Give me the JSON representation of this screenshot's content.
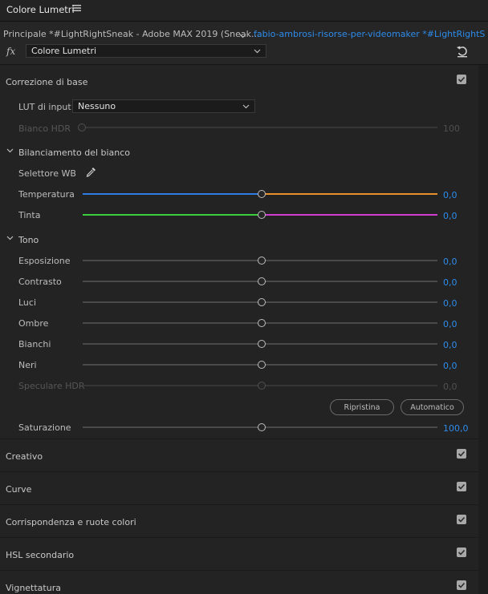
{
  "panel": {
    "title": "Colore Lumetri",
    "menu_icon": "hamburger-icon"
  },
  "sequence": {
    "left": "Principale *#LightRightSneak - Adobe MAX 2019 (Sneak...",
    "right": "fabio-ambrosi-risorse-per-videomaker *#LightRightS..."
  },
  "effect": {
    "fx_label": "fx",
    "selected": "Colore Lumetri",
    "reset_icon": "reset-icon"
  },
  "colors": {
    "accent": "#2d8ceb",
    "temp_cool": "#2f7de0",
    "temp_warm": "#e8912c",
    "tint_green": "#3ccf3c",
    "tint_magenta": "#d03cd0"
  },
  "basic": {
    "title": "Correzione di base",
    "lut_label": "LUT di input",
    "lut_value": "Nessuno",
    "hdr_label": "Bianco HDR",
    "hdr_value": "100",
    "wb": {
      "title": "Bilanciamento del bianco",
      "picker_label": "Selettore WB",
      "temp_label": "Temperatura",
      "temp_value": "0,0",
      "tint_label": "Tinta",
      "tint_value": "0,0"
    },
    "tone": {
      "title": "Tono",
      "sliders": [
        {
          "label": "Esposizione",
          "value": "0,0"
        },
        {
          "label": "Contrasto",
          "value": "0,0"
        },
        {
          "label": "Luci",
          "value": "0,0"
        },
        {
          "label": "Ombre",
          "value": "0,0"
        },
        {
          "label": "Bianchi",
          "value": "0,0"
        },
        {
          "label": "Neri",
          "value": "0,0"
        },
        {
          "label": "Speculare HDR",
          "value": "0,0"
        }
      ],
      "reset_button": "Ripristina",
      "auto_button": "Automatico"
    },
    "saturation_label": "Saturazione",
    "saturation_value": "100,0"
  },
  "sections": [
    {
      "title": "Creativo"
    },
    {
      "title": "Curve"
    },
    {
      "title": "Corrispondenza e ruote colori"
    },
    {
      "title": "HSL secondario"
    },
    {
      "title": "Vignettatura"
    }
  ]
}
